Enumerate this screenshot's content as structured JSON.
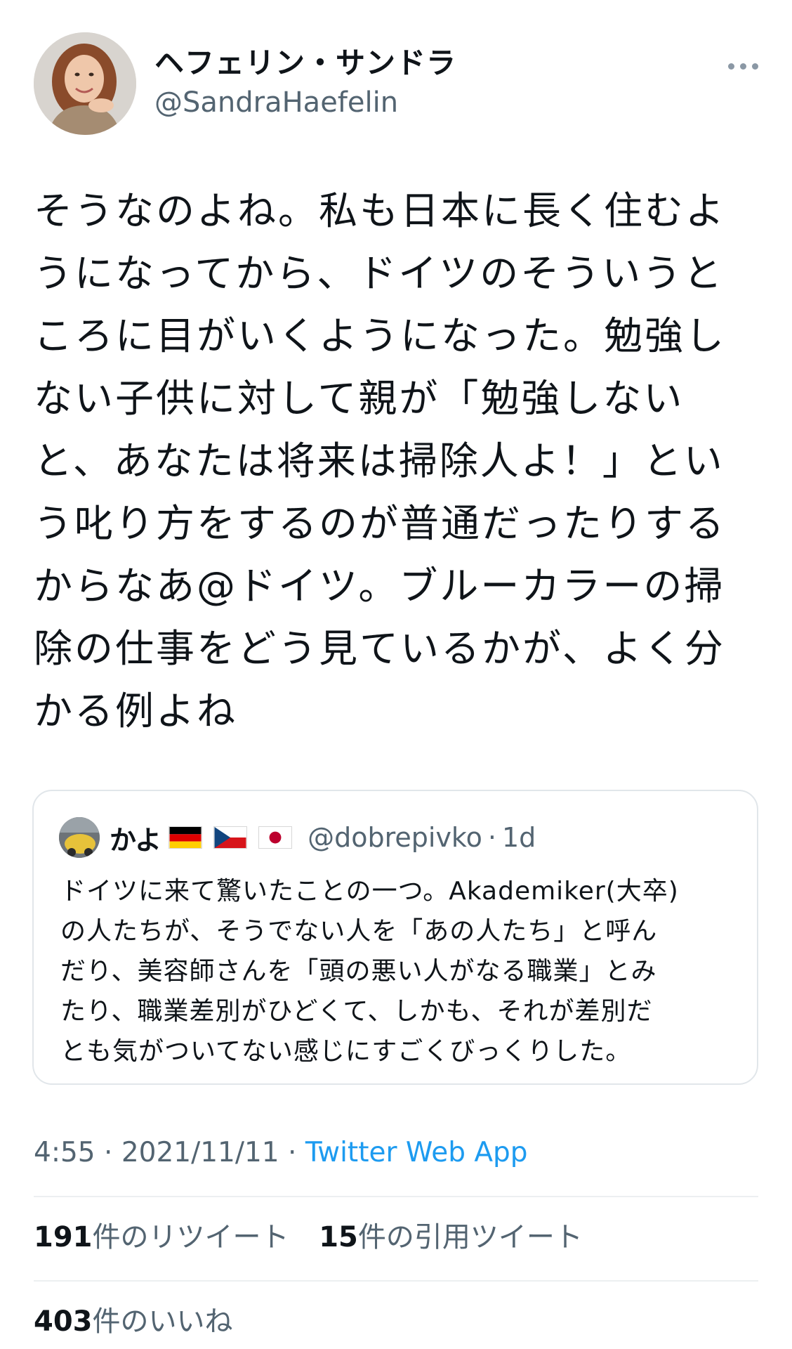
{
  "author": {
    "display_name": "ヘフェリン・サンドラ",
    "handle": "@SandraHaefelin",
    "avatar_icon": "user-avatar-photo"
  },
  "more_icon": "more-dots-icon",
  "tweet": {
    "text": "そうなのよね。私も日本に長く住むよ\nうになってから、ドイツのそういうと\nころに目がいくようになった。勉強し\nない子供に対して親が「勉強しない\nと、あなたは将来は掃除人よ！」とい\nう叱り方をするのが普通だったりする\nからなあ@ドイツ。ブルーカラーの掃\n除の仕事をどう見ているかが、よく分\nかる例よね"
  },
  "quoted": {
    "name": "かよ",
    "flags": [
      "germany-flag-icon",
      "czech-flag-icon",
      "japan-flag-icon"
    ],
    "handle": "@dobrepivko",
    "separator": "·",
    "time": "1d",
    "text": "ドイツに来て驚いたことの一つ。Akademiker(大卒)\nの人たちが、そうでない人を「あの人たち」と呼ん\nだり、美容師さんを「頭の悪い人がなる職業」とみ\nたり、職業差別がひどくて、しかも、それが差別だ\nとも気がついてない感じにすごくびっくりした。"
  },
  "meta": {
    "time": "4:55",
    "sep1": "·",
    "date": "2021/11/11",
    "sep2": "·",
    "source": "Twitter Web App"
  },
  "stats": {
    "retweets_count": "191",
    "retweets_label": "件のリツイート",
    "quotes_count": "15",
    "quotes_label": "件の引用ツイート",
    "likes_count": "403",
    "likes_label": "件のいいね"
  },
  "colors": {
    "text": "#0f1419",
    "secondary": "#536471",
    "link": "#1d9bf0",
    "border": "#e1e6ea"
  }
}
